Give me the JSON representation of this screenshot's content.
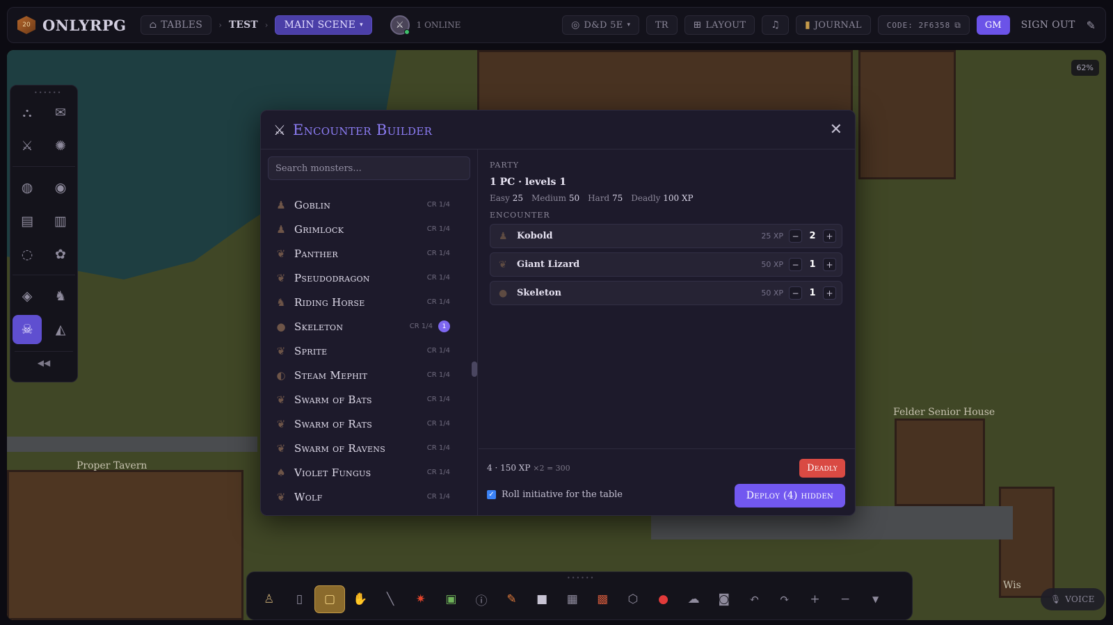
{
  "topbar": {
    "logo_die": "20",
    "brand": "ONLYRPG",
    "tables_label": "TABLES",
    "crumb_table": "TEST",
    "scene_label": "MAIN SCENE",
    "online_label": "1 ONLINE",
    "system_label": "D&D 5E",
    "lang_label": "TR",
    "layout_label": "LAYOUT",
    "journal_label": "JOURNAL",
    "code_label": "CODE: 2F6358",
    "gm_label": "GM",
    "signout_label": "SIGN OUT"
  },
  "map": {
    "zoom": "62%",
    "labels": [
      "Proper Tavern",
      "Felder Senior House",
      "Wis"
    ]
  },
  "modal": {
    "title": "Encounter Builder",
    "search_placeholder": "Search monsters...",
    "monsters": [
      {
        "name": "Goblin",
        "cr": "CR 1/4"
      },
      {
        "name": "Grimlock",
        "cr": "CR 1/4"
      },
      {
        "name": "Panther",
        "cr": "CR 1/4"
      },
      {
        "name": "Pseudodragon",
        "cr": "CR 1/4"
      },
      {
        "name": "Riding Horse",
        "cr": "CR 1/4"
      },
      {
        "name": "Skeleton",
        "cr": "CR 1/4",
        "count": "1"
      },
      {
        "name": "Sprite",
        "cr": "CR 1/4"
      },
      {
        "name": "Steam Mephit",
        "cr": "CR 1/4"
      },
      {
        "name": "Swarm of Bats",
        "cr": "CR 1/4"
      },
      {
        "name": "Swarm of Rats",
        "cr": "CR 1/4"
      },
      {
        "name": "Swarm of Ravens",
        "cr": "CR 1/4"
      },
      {
        "name": "Violet Fungus",
        "cr": "CR 1/4"
      },
      {
        "name": "Wolf",
        "cr": "CR 1/4"
      }
    ],
    "party_label": "PARTY",
    "party_summary": "1 PC · levels 1",
    "thresholds": [
      {
        "label": "Easy",
        "value": "25"
      },
      {
        "label": "Medium",
        "value": "50"
      },
      {
        "label": "Hard",
        "value": "75"
      },
      {
        "label": "Deadly",
        "value": "100 XP"
      }
    ],
    "encounter_label": "ENCOUNTER",
    "encounter": [
      {
        "name": "Kobold",
        "xp": "25 XP",
        "qty": "2"
      },
      {
        "name": "Giant Lizard",
        "xp": "50 XP",
        "qty": "1"
      },
      {
        "name": "Skeleton",
        "xp": "50 XP",
        "qty": "1"
      }
    ],
    "total_text": "4 · 150 XP",
    "total_mult": "×2 = 300",
    "difficulty": "Deadly",
    "roll_initiative_label": "Roll initiative for the table",
    "deploy_label": "Deploy (4) hidden"
  },
  "voice_label": "VOICE",
  "colors": {
    "accent": "#7258f0",
    "deadly": "#d94a43",
    "gm": "#6b53e8"
  }
}
